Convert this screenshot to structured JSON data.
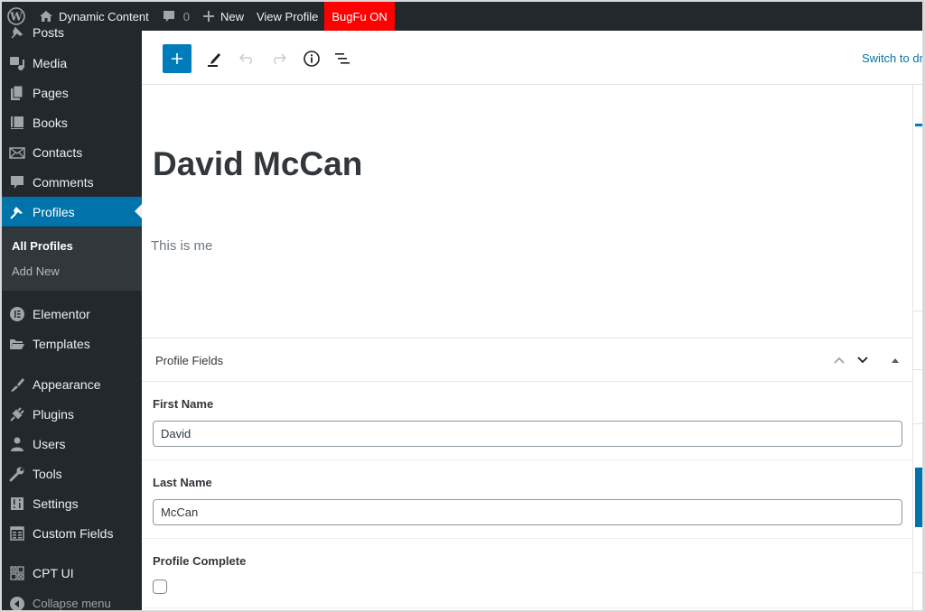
{
  "adminbar": {
    "wp_logo": "wordpress-logo",
    "site_name": "Dynamic Content",
    "comments_count": "0",
    "new_label": "New",
    "view_label": "View Profile",
    "bugfu_label": "BugFu ON",
    "bugfu_color": "#ff0000"
  },
  "sidebar": {
    "items": [
      {
        "label": "Posts",
        "icon": "pin-icon"
      },
      {
        "label": "Media",
        "icon": "media-icon"
      },
      {
        "label": "Pages",
        "icon": "pages-icon"
      },
      {
        "label": "Books",
        "icon": "book-icon"
      },
      {
        "label": "Contacts",
        "icon": "envelope-icon"
      },
      {
        "label": "Comments",
        "icon": "comment-icon"
      },
      {
        "label": "Profiles",
        "icon": "pin-icon",
        "active": true
      },
      {
        "label": "Elementor",
        "icon": "elementor-icon"
      },
      {
        "label": "Templates",
        "icon": "folder-icon"
      },
      {
        "label": "Appearance",
        "icon": "brush-icon"
      },
      {
        "label": "Plugins",
        "icon": "plug-icon"
      },
      {
        "label": "Users",
        "icon": "user-icon"
      },
      {
        "label": "Tools",
        "icon": "wrench-icon"
      },
      {
        "label": "Settings",
        "icon": "settings-icon"
      },
      {
        "label": "Custom Fields",
        "icon": "table-icon"
      },
      {
        "label": "CPT UI",
        "icon": "grid-icon"
      }
    ],
    "submenu": [
      {
        "label": "All Profiles",
        "current": true
      },
      {
        "label": "Add New"
      }
    ],
    "collapse_label": "Collapse menu",
    "accent": "#0073aa"
  },
  "toolbar": {
    "switch_label": "Switch to dra"
  },
  "post": {
    "title": "David McCan",
    "paragraph": "This is me"
  },
  "metabox": {
    "title": "Profile Fields",
    "fields": [
      {
        "label": "First Name",
        "value": "David"
      },
      {
        "label": "Last Name",
        "value": "McCan"
      },
      {
        "label": "Profile Complete",
        "checked": false
      }
    ]
  }
}
